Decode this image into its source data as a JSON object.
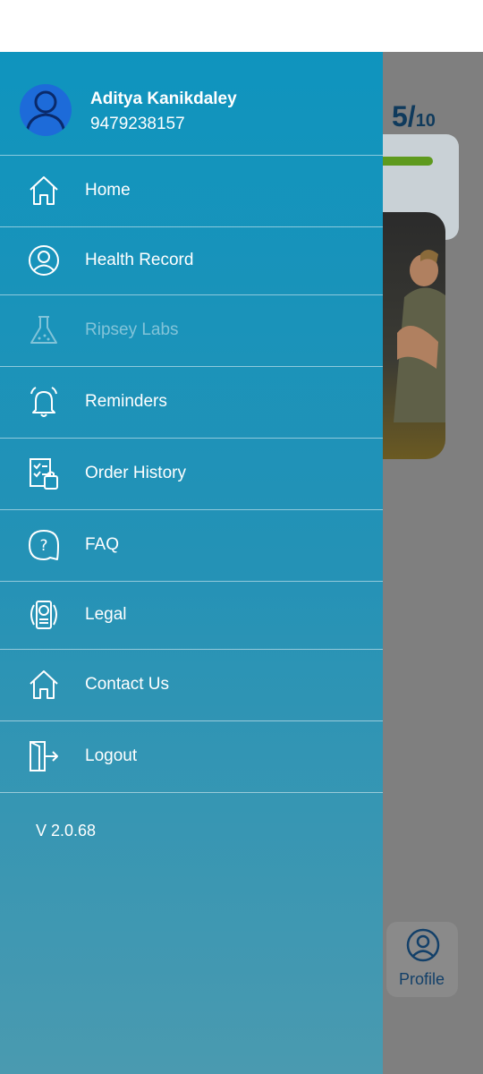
{
  "background": {
    "score": {
      "value": "5/",
      "total": "10"
    },
    "bottom_nav": {
      "profile_label": "Profile"
    }
  },
  "drawer": {
    "user": {
      "name": "Aditya Kanikdaley",
      "phone": "9479238157"
    },
    "items": [
      {
        "label": "Home",
        "icon": "home-icon",
        "enabled": true
      },
      {
        "label": "Health Record",
        "icon": "user-circle-icon",
        "enabled": true
      },
      {
        "label": "Ripsey Labs",
        "icon": "flask-icon",
        "enabled": false
      },
      {
        "label": "Reminders",
        "icon": "bell-icon",
        "enabled": true
      },
      {
        "label": "Order History",
        "icon": "order-list-icon",
        "enabled": true
      },
      {
        "label": "FAQ",
        "icon": "question-bubble-icon",
        "enabled": true
      },
      {
        "label": "Legal",
        "icon": "certificate-icon",
        "enabled": true
      },
      {
        "label": "Contact Us",
        "icon": "home-icon",
        "enabled": true
      },
      {
        "label": "Logout",
        "icon": "logout-icon",
        "enabled": true
      }
    ],
    "version": "V 2.0.68"
  },
  "colors": {
    "drawer_top": "#0f94be",
    "drawer_bottom": "#4a9ab0",
    "overlay": "#7f7f7f",
    "score_text": "#0f3a5c",
    "progress_green": "#5e9a1e"
  }
}
